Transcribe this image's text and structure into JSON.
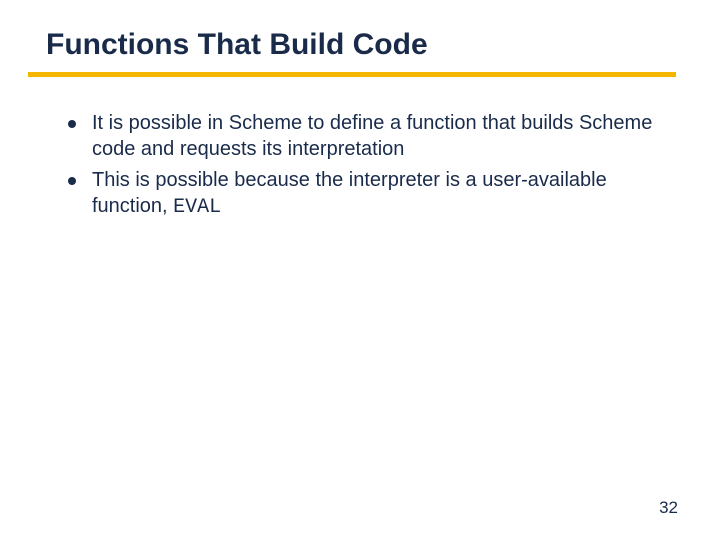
{
  "slide": {
    "title": "Functions That Build Code",
    "bullets": [
      {
        "text": "It is possible in Scheme to define a function that builds Scheme code and requests its interpretation"
      },
      {
        "text_prefix": "This is possible because the interpreter is a user-available function, ",
        "code": "EVAL"
      }
    ],
    "page_number": "32"
  }
}
